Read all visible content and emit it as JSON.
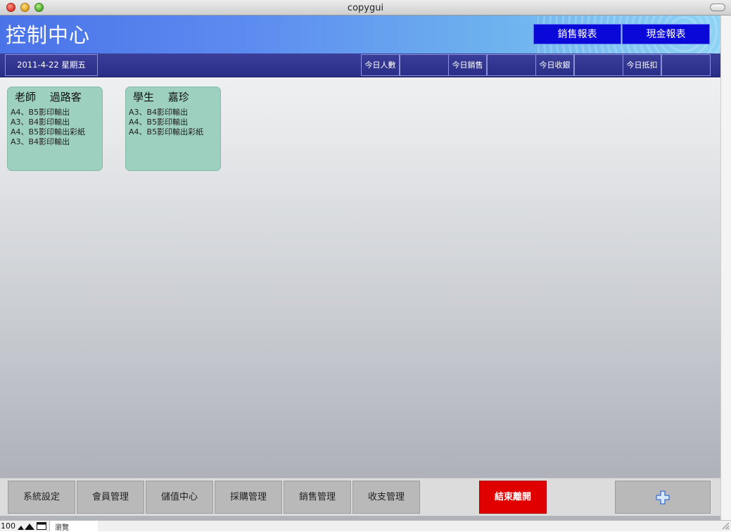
{
  "window": {
    "title": "copygui"
  },
  "header": {
    "title": "控制中心",
    "sales_report": "銷售報表",
    "cash_report": "現金報表"
  },
  "infobar": {
    "date": "2011-4-22 星期五",
    "stats": [
      {
        "label": "今日人數",
        "value": ""
      },
      {
        "label": "今日銷售",
        "value": ""
      },
      {
        "label": "今日收銀",
        "value": ""
      },
      {
        "label": "今日抵扣",
        "value": ""
      }
    ]
  },
  "cards": [
    {
      "name": "老師　 過路客",
      "items": [
        "A4、B5影印輸出",
        "A3、B4影印輸出",
        "A4、B5影印輸出彩紙",
        "A3、B4影印輸出"
      ]
    },
    {
      "name": "學生　 嘉珍",
      "items": [
        "A3、B4影印輸出",
        "A4、B5影印輸出",
        "A4、B5影印輸出彩紙"
      ]
    }
  ],
  "toolbar": {
    "buttons": [
      "系統設定",
      "會員管理",
      "儲值中心",
      "採購管理",
      "銷售管理",
      "收支管理"
    ],
    "exit": "結束離開",
    "add_icon": "plus-icon"
  },
  "statusbar": {
    "zoom": "100",
    "mode": "瀏覽"
  },
  "colors": {
    "header_blue": "#4a73e8",
    "report_button": "#0a08d8",
    "exit_red": "#e00000",
    "card_green": "#9dd0bf",
    "infobar": "#2a2d86"
  }
}
